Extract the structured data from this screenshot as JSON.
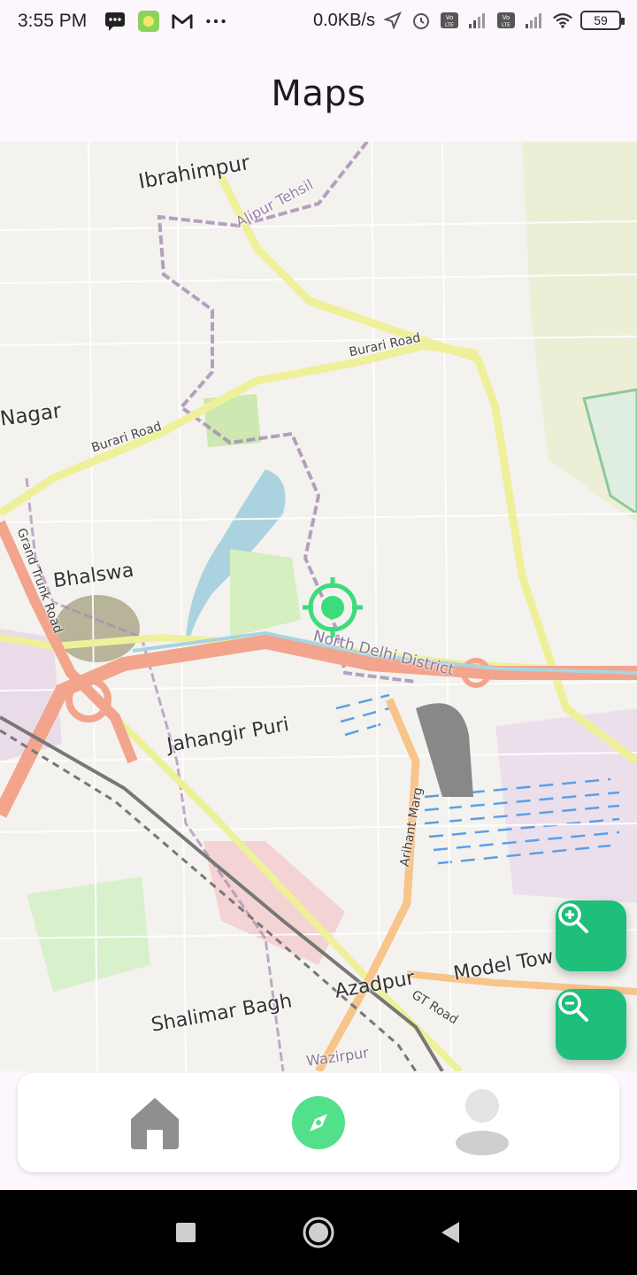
{
  "status_bar": {
    "time": "3:55 PM",
    "network_speed": "0.0KB/s",
    "battery_level": "59",
    "icons": [
      "message-icon",
      "app-icon",
      "gmail-icon",
      "more-icon",
      "location-icon",
      "alarm-icon",
      "volte-icon",
      "signal-icon",
      "volte-icon",
      "signal-icon",
      "wifi-icon",
      "battery-icon"
    ]
  },
  "app_bar": {
    "title": "Maps"
  },
  "map": {
    "place_labels": [
      "Ibrahimpur",
      "Alipur Tehsil",
      "Nagar",
      "Bhalswa",
      "Jahangir Puri",
      "North Delhi District",
      "Shalimar Bagh",
      "Azadpur",
      "Model Tow",
      "Wazirpur"
    ],
    "road_labels": [
      "Burari Road",
      "Burari Road",
      "Grand Trunk Road",
      "Arihant Marg",
      "GT Road"
    ],
    "marker": "current-location-icon",
    "zoom_in": "zoom-in-icon",
    "zoom_out": "zoom-out-icon"
  },
  "bottom_nav": {
    "items": [
      {
        "name": "home",
        "icon": "home-icon"
      },
      {
        "name": "explore",
        "icon": "compass-icon",
        "active": true
      },
      {
        "name": "profile",
        "icon": "person-icon"
      }
    ],
    "active_color": "#52e08a"
  },
  "system_nav": [
    "recents-button",
    "home-button",
    "back-button"
  ],
  "colors": {
    "accent": "#1dbf7a",
    "background": "#fdf6fd"
  }
}
